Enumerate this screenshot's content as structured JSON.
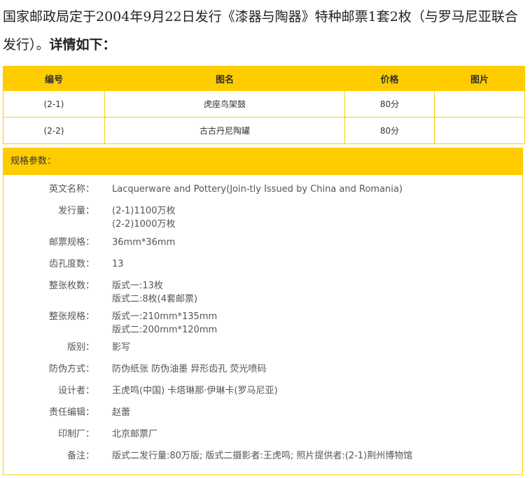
{
  "intro": {
    "line": "国家邮政局定于2004年9月22日发行《漆器与陶器》特种邮票1套2枚（与罗马尼亚联合发行）。",
    "tail": "详情如下："
  },
  "stamp_table": {
    "headers": [
      "编号",
      "图名",
      "价格",
      "图片"
    ],
    "rows": [
      [
        "(2-1)",
        "虎座鸟架鼓",
        "80分",
        ""
      ],
      [
        "(2-2)",
        "古古丹尼陶罐",
        "80分",
        ""
      ]
    ]
  },
  "spec": {
    "heading": "规格参数：",
    "items": [
      {
        "label": "英文名称：",
        "lines": [
          "Lacquerware and Pottery(Join-tly Issued by China and Romania)"
        ]
      },
      {
        "label": "发行量：",
        "lines": [
          "(2-1)1100万枚",
          "(2-2)1000万枚"
        ]
      },
      {
        "label": "邮票规格：",
        "lines": [
          "36mm*36mm"
        ]
      },
      {
        "label": "齿孔度数：",
        "lines": [
          "13"
        ]
      },
      {
        "label": "整张枚数：",
        "lines": [
          "版式一:13枚",
          "版式二:8枚(4套邮票)"
        ]
      },
      {
        "label": "整张规格：",
        "lines": [
          "版式一:210mm*135mm",
          "版式二:200mm*120mm"
        ]
      },
      {
        "label": "版别：",
        "lines": [
          "影写"
        ]
      },
      {
        "label": "防伪方式：",
        "lines": [
          "防伪纸张 防伪油墨 异形齿孔 荧光喷码"
        ]
      },
      {
        "label": "设计者：",
        "lines": [
          "王虎鸣(中国) 卡塔琳那·伊琳卡(罗马尼亚)"
        ]
      },
      {
        "label": "责任编辑：",
        "lines": [
          "赵蕾"
        ]
      },
      {
        "label": "印制厂：",
        "lines": [
          "北京邮票厂"
        ]
      },
      {
        "label": "备注：",
        "lines": [
          "版式二发行量:80万版; 版式二摄影者:王虎鸣; 照片提供者:(2-1)荆州博物馆"
        ]
      }
    ]
  },
  "colors": {
    "accent": "#ffcc00",
    "text": "#333333"
  }
}
